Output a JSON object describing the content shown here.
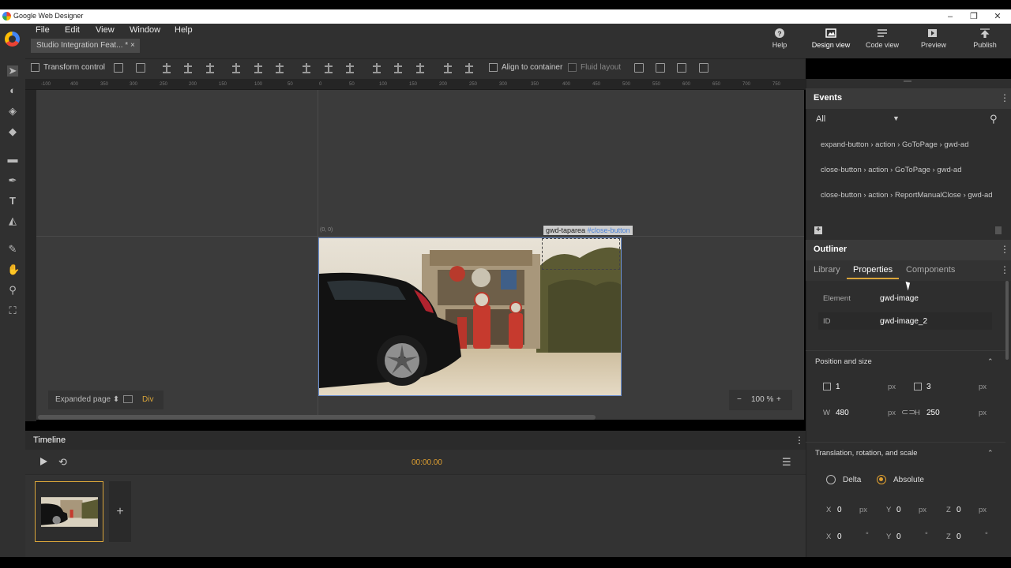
{
  "window": {
    "title": "Google Web Designer",
    "min": "–",
    "max": "❐",
    "close": "✕"
  },
  "menu": [
    "File",
    "Edit",
    "View",
    "Window",
    "Help"
  ],
  "doc_tab": "Studio Integration Feat... * ×",
  "header_buttons": {
    "help": "Help",
    "design_view": "Design view",
    "code_view": "Code view",
    "preview": "Preview",
    "publish": "Publish"
  },
  "toolbar": {
    "transform_control": "Transform control",
    "align_to_container": "Align to container",
    "fluid_layout": "Fluid layout"
  },
  "ruler_h": [
    "-100",
    "400",
    "350",
    "300",
    "250",
    "200",
    "150",
    "100",
    "50",
    "0",
    "50",
    "100",
    "150",
    "200",
    "250",
    "300",
    "350",
    "400",
    "450",
    "500",
    "550",
    "600",
    "650",
    "700",
    "750"
  ],
  "stage": {
    "origin": "(0, 0)",
    "tap_label_main": "gwd-taparea ",
    "tap_label_id": "#close-button",
    "page_selector": "Expanded page ⬍",
    "element_type": "Div",
    "zoom": "100 %",
    "zoom_minus": "−",
    "zoom_plus": "+"
  },
  "timeline": {
    "title": "Timeline",
    "time": "00:00.00",
    "add": "+"
  },
  "events": {
    "title": "Events",
    "filter": "All",
    "items": [
      "expand-button › action › GoToPage › gwd-ad",
      "close-button › action › GoToPage › gwd-ad",
      "close-button › action › ReportManualClose › gwd-ad"
    ]
  },
  "outliner": {
    "title": "Outliner"
  },
  "tabs": [
    "Library",
    "Properties",
    "Components"
  ],
  "properties": {
    "element_label": "Element",
    "element_value": "gwd-image",
    "id_label": "ID",
    "id_value": "gwd-image_2",
    "position_title": "Position and size",
    "left": "1",
    "top": "3",
    "w_label": "W",
    "w": "480",
    "h_label": "H",
    "h": "250",
    "unit": "px",
    "trs_title": "Translation, rotation, and scale",
    "delta": "Delta",
    "absolute": "Absolute",
    "x_label": "X",
    "y_label": "Y",
    "z_label": "Z",
    "tx": "0",
    "ty": "0",
    "tz": "0",
    "rx": "0",
    "ry": "0",
    "rz": "0",
    "deg": "°"
  },
  "colors": {
    "accent": "#e0a030",
    "selection": "#6a8fd0",
    "panel": "#2e2e2e"
  }
}
